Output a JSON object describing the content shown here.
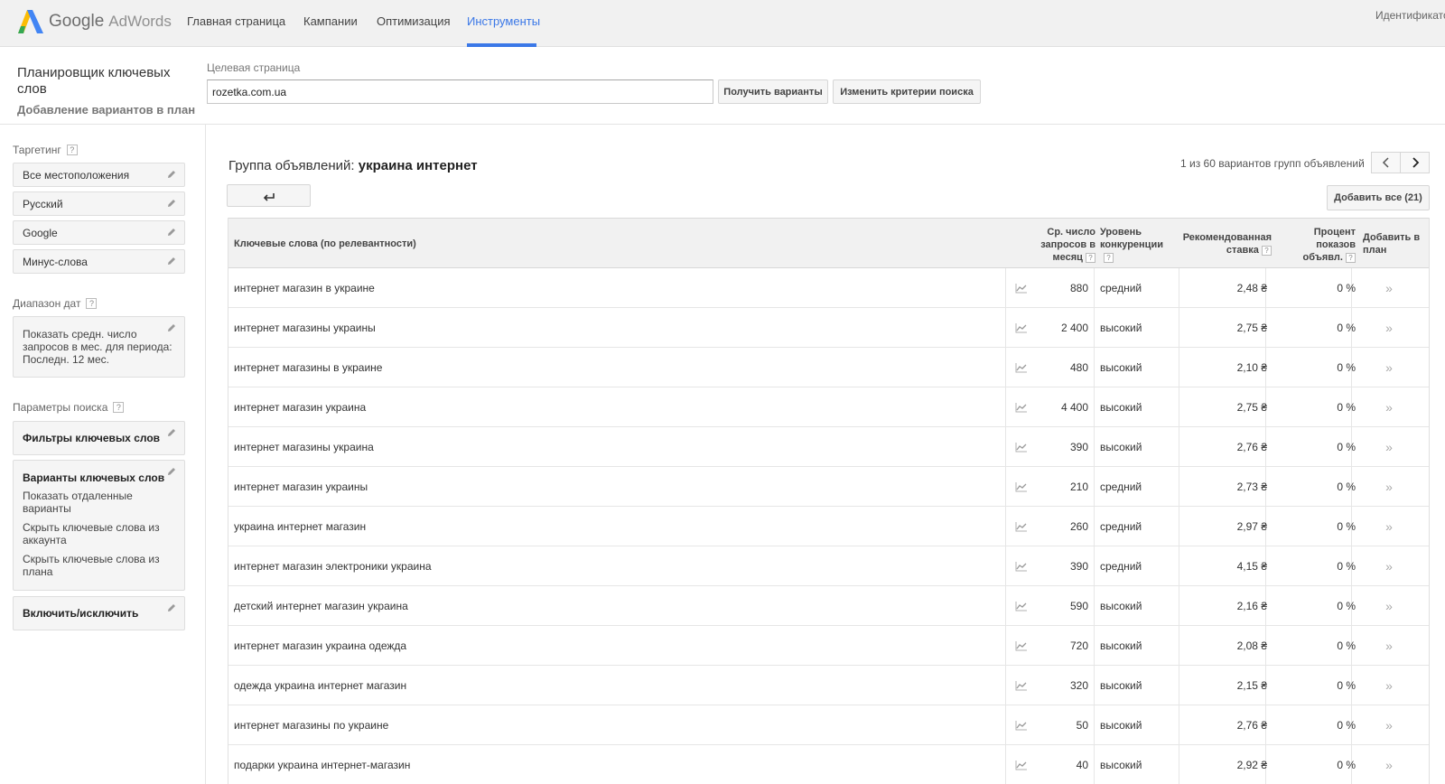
{
  "nav": {
    "logo_google": "Google",
    "logo_product": "AdWords",
    "items": [
      {
        "label": "Главная страница"
      },
      {
        "label": "Кампании"
      },
      {
        "label": "Оптимизация"
      },
      {
        "label": "Инструменты",
        "active": true
      }
    ],
    "account_id": "Идентификатор",
    "accent_color": "#3b78e7"
  },
  "header": {
    "title": "Планировщик ключевых слов",
    "subtitle": "Добавление вариантов в план",
    "landing_label": "Целевая страница",
    "landing_value": "rozetka.com.ua",
    "get_ideas_button": "Получить варианты",
    "modify_search_button": "Изменить критерии поиска"
  },
  "sidebar": {
    "targeting_label": "Таргетинг",
    "targeting_items": [
      "Все местоположения",
      "Русский",
      "Google",
      "Минус-слова"
    ],
    "date_range_label": "Диапазон дат",
    "date_range_text": [
      "Показать средн. число",
      "запросов в мес. для периода:",
      "Последн. 12 мес."
    ],
    "search_params_label": "Параметры поиска",
    "keyword_filters": "Фильтры ключевых слов",
    "keyword_options_title": "Варианты ключевых слов",
    "keyword_options": [
      [
        "Показать отдаленные",
        "варианты"
      ],
      [
        "Скрыть ключевые слова из",
        "аккаунта"
      ],
      [
        "Скрыть ключевые слова из",
        "плана"
      ]
    ],
    "include_exclude": "Включить/исключить",
    "help_mark": "?"
  },
  "main": {
    "group_prefix": "Группа объявлений:",
    "group_name": "украина интернет",
    "pager_text": "1 из 60 вариантов групп объявлений",
    "add_all_button": "Добавить все (21)",
    "columns": {
      "keyword": "Ключевые слова (по релевантности)",
      "volume": [
        "Ср. число",
        "запросов в",
        "месяц"
      ],
      "competition": [
        "Уровень",
        "конкуренции"
      ],
      "bid": [
        "Рекомендованная",
        "ставка"
      ],
      "share": [
        "Процент",
        "показов",
        "объявл."
      ],
      "add": [
        "Добавить в",
        "план"
      ]
    },
    "rows": [
      {
        "keyword": "интернет магазин в украине",
        "volume": "880",
        "competition": "средний",
        "bid": "2,48 ₴",
        "share": "0 %"
      },
      {
        "keyword": "интернет магазины украины",
        "volume": "2 400",
        "competition": "высокий",
        "bid": "2,75 ₴",
        "share": "0 %"
      },
      {
        "keyword": "интернет магазины в украине",
        "volume": "480",
        "competition": "высокий",
        "bid": "2,10 ₴",
        "share": "0 %"
      },
      {
        "keyword": "интернет магазин украина",
        "volume": "4 400",
        "competition": "высокий",
        "bid": "2,75 ₴",
        "share": "0 %"
      },
      {
        "keyword": "интернет магазины украина",
        "volume": "390",
        "competition": "высокий",
        "bid": "2,76 ₴",
        "share": "0 %"
      },
      {
        "keyword": "интернет магазин украины",
        "volume": "210",
        "competition": "средний",
        "bid": "2,73 ₴",
        "share": "0 %"
      },
      {
        "keyword": "украина интернет магазин",
        "volume": "260",
        "competition": "средний",
        "bid": "2,97 ₴",
        "share": "0 %"
      },
      {
        "keyword": "интернет магазин электроники украина",
        "volume": "390",
        "competition": "средний",
        "bid": "4,15 ₴",
        "share": "0 %"
      },
      {
        "keyword": "детский интернет магазин украина",
        "volume": "590",
        "competition": "высокий",
        "bid": "2,16 ₴",
        "share": "0 %"
      },
      {
        "keyword": "интернет магазин украина одежда",
        "volume": "720",
        "competition": "высокий",
        "bid": "2,08 ₴",
        "share": "0 %"
      },
      {
        "keyword": "одежда украина интернет магазин",
        "volume": "320",
        "competition": "высокий",
        "bid": "2,15 ₴",
        "share": "0 %"
      },
      {
        "keyword": "интернет магазины по украине",
        "volume": "50",
        "competition": "высокий",
        "bid": "2,76 ₴",
        "share": "0 %"
      },
      {
        "keyword": "подарки украина интернет-магазин",
        "volume": "40",
        "competition": "высокий",
        "bid": "2,92 ₴",
        "share": "0 %"
      }
    ]
  }
}
